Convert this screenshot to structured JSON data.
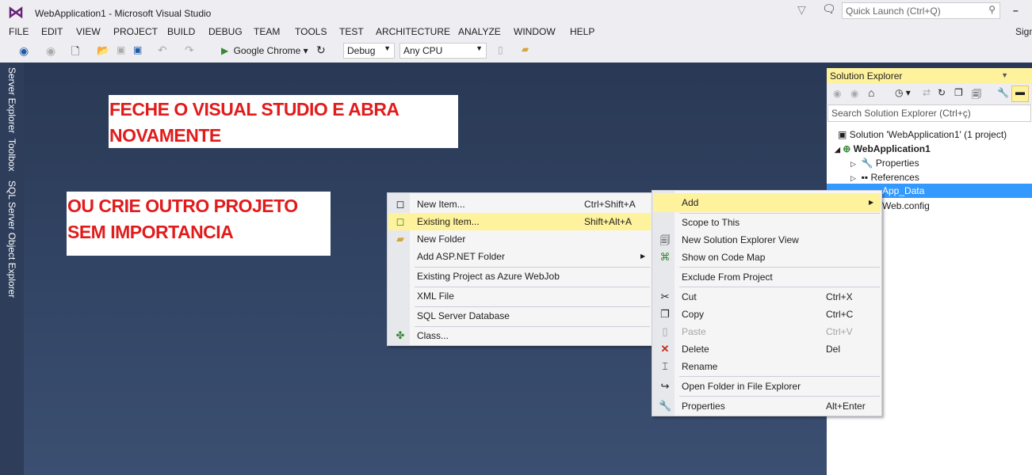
{
  "window": {
    "title": "WebApplication1 - Microsoft Visual Studio",
    "quick_launch_placeholder": "Quick Launch (Ctrl+Q)",
    "sign_in": "Sign"
  },
  "menu": [
    "FILE",
    "EDIT",
    "VIEW",
    "PROJECT",
    "BUILD",
    "DEBUG",
    "TEAM",
    "TOOLS",
    "TEST",
    "ARCHITECTURE",
    "ANALYZE",
    "WINDOW",
    "HELP"
  ],
  "toolbar": {
    "run_target": "Google Chrome",
    "configuration": "Debug",
    "platform": "Any CPU"
  },
  "side_tabs": [
    "Server Explorer",
    "Toolbox",
    "SQL Server Object Explorer"
  ],
  "notes": [
    "FECHE O VISUAL STUDIO E ABRA NOVAMENTE",
    "OU CRIE OUTRO PROJETO SEM IMPORTANCIA"
  ],
  "solution_explorer": {
    "title": "Solution Explorer",
    "search_placeholder": "Search Solution Explorer (Ctrl+ç)",
    "tree": [
      "Solution 'WebApplication1' (1 project)",
      "WebApplication1",
      "Properties",
      "References",
      "App_Data",
      "Web.config"
    ]
  },
  "context_menu": {
    "items": [
      {
        "label": "Add",
        "shortcut": ""
      },
      {
        "label": "Scope to This",
        "shortcut": ""
      },
      {
        "label": "New Solution Explorer View",
        "shortcut": ""
      },
      {
        "label": "Show on Code Map",
        "shortcut": ""
      },
      {
        "label": "Exclude From Project",
        "shortcut": ""
      },
      {
        "label": "Cut",
        "shortcut": "Ctrl+X"
      },
      {
        "label": "Copy",
        "shortcut": "Ctrl+C"
      },
      {
        "label": "Paste",
        "shortcut": "Ctrl+V"
      },
      {
        "label": "Delete",
        "shortcut": "Del"
      },
      {
        "label": "Rename",
        "shortcut": ""
      },
      {
        "label": "Open Folder in File Explorer",
        "shortcut": ""
      },
      {
        "label": "Properties",
        "shortcut": "Alt+Enter"
      }
    ]
  },
  "add_submenu": {
    "items": [
      {
        "label": "New Item...",
        "shortcut": "Ctrl+Shift+A"
      },
      {
        "label": "Existing Item...",
        "shortcut": "Shift+Alt+A"
      },
      {
        "label": "New Folder",
        "shortcut": ""
      },
      {
        "label": "Add ASP.NET Folder",
        "shortcut": ""
      },
      {
        "label": "Existing Project as Azure WebJob",
        "shortcut": ""
      },
      {
        "label": "XML File",
        "shortcut": ""
      },
      {
        "label": "SQL Server Database",
        "shortcut": ""
      },
      {
        "label": "Class...",
        "shortcut": ""
      }
    ]
  }
}
